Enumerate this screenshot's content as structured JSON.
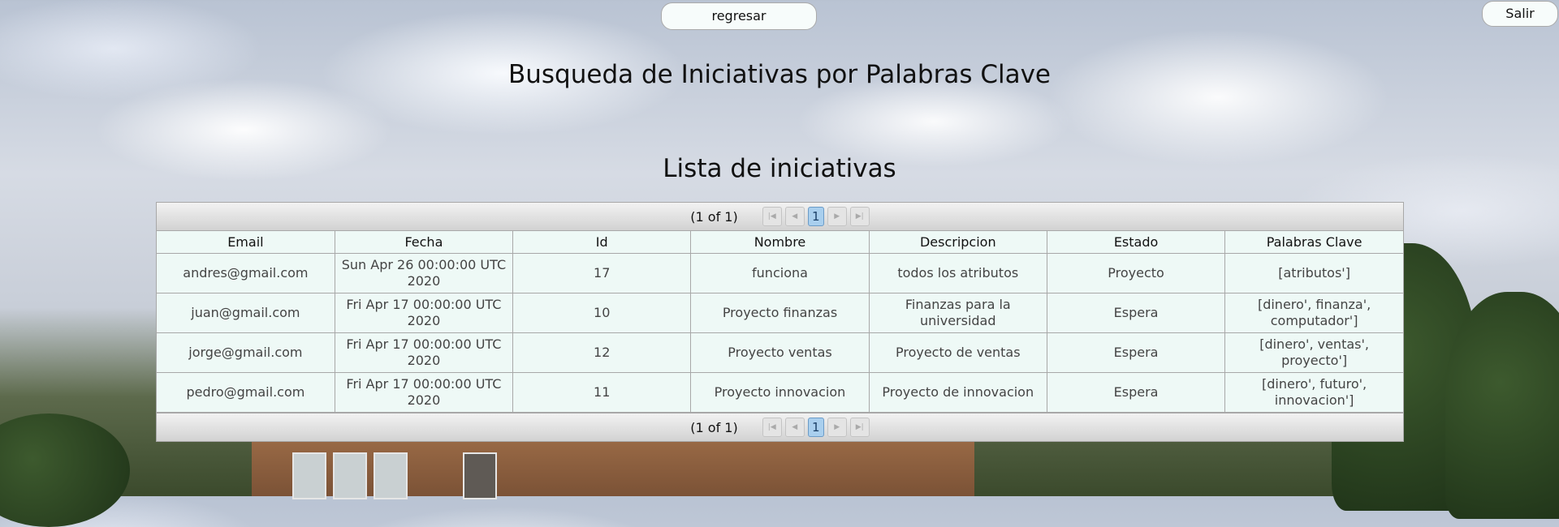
{
  "header": {
    "back_label": "regresar",
    "logout_label": "Salir"
  },
  "title": "Busqueda de Iniciativas por Palabras Clave",
  "subtitle": "Lista de iniciativas",
  "paginator": {
    "report": "(1 of 1)",
    "first_icon": "first-page-icon",
    "prev_icon": "prev-page-icon",
    "page": "1",
    "next_icon": "next-page-icon",
    "last_icon": "last-page-icon"
  },
  "table": {
    "headers": [
      "Email",
      "Fecha",
      "Id",
      "Nombre",
      "Descripcion",
      "Estado",
      "Palabras Clave"
    ],
    "rows": [
      [
        "andres@gmail.com",
        "Sun Apr 26 00:00:00 UTC 2020",
        "17",
        "funciona",
        "todos los atributos",
        "Proyecto",
        "[atributos']"
      ],
      [
        "juan@gmail.com",
        "Fri Apr 17 00:00:00 UTC 2020",
        "10",
        "Proyecto finanzas",
        "Finanzas para la universidad",
        "Espera",
        "[dinero', finanza', computador']"
      ],
      [
        "jorge@gmail.com",
        "Fri Apr 17 00:00:00 UTC 2020",
        "12",
        "Proyecto ventas",
        "Proyecto de ventas",
        "Espera",
        "[dinero', ventas', proyecto']"
      ],
      [
        "pedro@gmail.com",
        "Fri Apr 17 00:00:00 UTC 2020",
        "11",
        "Proyecto innovacion",
        "Proyecto de innovacion",
        "Espera",
        "[dinero', futuro', innovacion']"
      ]
    ]
  }
}
